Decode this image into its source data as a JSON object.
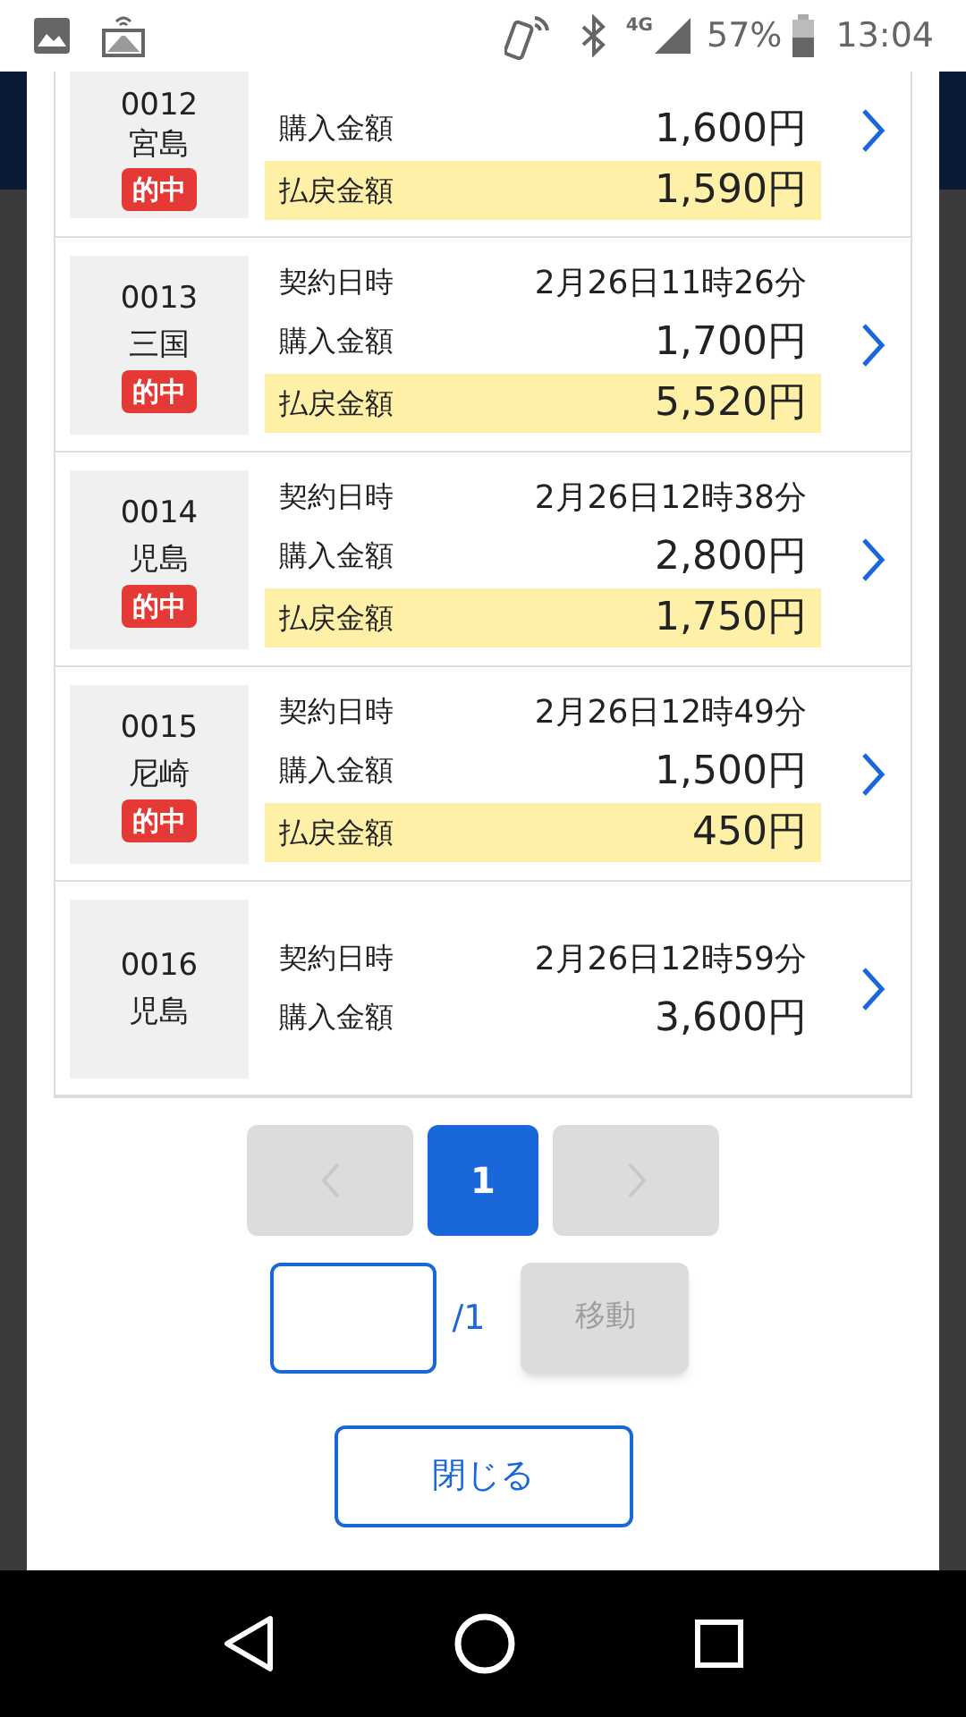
{
  "status_bar": {
    "network": "4G",
    "battery": "57%",
    "time": "13:04"
  },
  "tickets": [
    {
      "number": "0012",
      "venue": "宮島",
      "hit_badge": "的中",
      "rows": [
        {
          "kind": "plain",
          "label": "購入金額",
          "value": "1,600円"
        },
        {
          "kind": "payout",
          "label": "払戻金額",
          "value": "1,590円"
        }
      ]
    },
    {
      "number": "0013",
      "venue": "三国",
      "hit_badge": "的中",
      "rows": [
        {
          "kind": "date",
          "label": "契約日時",
          "value": "2月26日11時26分"
        },
        {
          "kind": "plain",
          "label": "購入金額",
          "value": "1,700円"
        },
        {
          "kind": "payout",
          "label": "払戻金額",
          "value": "5,520円"
        }
      ]
    },
    {
      "number": "0014",
      "venue": "児島",
      "hit_badge": "的中",
      "rows": [
        {
          "kind": "date",
          "label": "契約日時",
          "value": "2月26日12時38分"
        },
        {
          "kind": "plain",
          "label": "購入金額",
          "value": "2,800円"
        },
        {
          "kind": "payout",
          "label": "払戻金額",
          "value": "1,750円"
        }
      ]
    },
    {
      "number": "0015",
      "venue": "尼崎",
      "hit_badge": "的中",
      "rows": [
        {
          "kind": "date",
          "label": "契約日時",
          "value": "2月26日12時49分"
        },
        {
          "kind": "plain",
          "label": "購入金額",
          "value": "1,500円"
        },
        {
          "kind": "payout",
          "label": "払戻金額",
          "value": "450円"
        }
      ]
    },
    {
      "number": "0016",
      "venue": "児島",
      "rows": [
        {
          "kind": "date",
          "label": "契約日時",
          "value": "2月26日12時59分"
        },
        {
          "kind": "plain",
          "label": "購入金額",
          "value": "3,600円"
        }
      ]
    }
  ],
  "pagination": {
    "prev_disabled": true,
    "next_disabled": true,
    "pages": [
      {
        "label": "1",
        "selected": true
      }
    ]
  },
  "jump": {
    "total": "/1",
    "button": {
      "label": "移動",
      "disabled": true
    }
  },
  "close_button": "閉じる"
}
